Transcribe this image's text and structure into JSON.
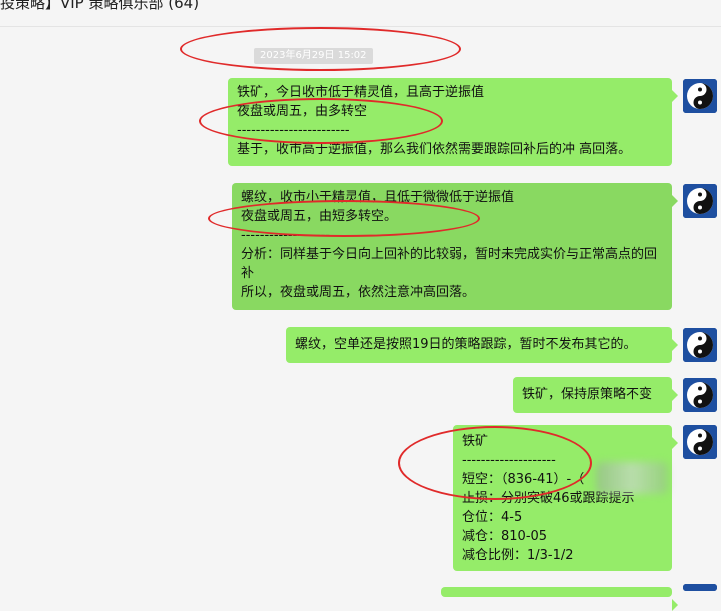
{
  "window": {
    "title": "投策略】VIP 策略俱乐部 (64)"
  },
  "chat": {
    "timestamp": "2023年6月29日 15:02",
    "messages": [
      {
        "lines": [
          "铁矿，今日收市低于精灵值，且高于逆振值",
          "夜盘或周五，由多转空",
          "------------------------",
          "基于，收市高于逆振值，那么我们依然需要跟踪回补后的冲 高回落。"
        ]
      },
      {
        "lines": [
          "螺纹，收市小于精灵值，且低于微微低于逆振值",
          "夜盘或周五，由短多转空。",
          "-------------------",
          "分析：同样基于今日向上回补的比较弱，暂时未完成实价与正常高点的回补",
          "所以，夜盘或周五，依然注意冲高回落。"
        ]
      },
      {
        "lines": [
          "螺纹，空单还是按照19日的策略跟踪，暂时不发布其它的。"
        ]
      },
      {
        "lines": [
          "铁矿，保持原策略不变"
        ]
      },
      {
        "lines": [
          "铁矿",
          "--------------------",
          "短空：（836-41）-（",
          "止损：分别突破46或跟踪提示",
          "仓位：4-5",
          "减仓：810-05",
          "减仓比例：1/3-1/2"
        ]
      }
    ]
  },
  "colors": {
    "bubble": "#95ec69",
    "bubble_selected": "#89d961",
    "annotation": "#e02a2a",
    "background": "#f5f5f5"
  },
  "icons": {
    "avatar": "yin-yang-icon"
  }
}
